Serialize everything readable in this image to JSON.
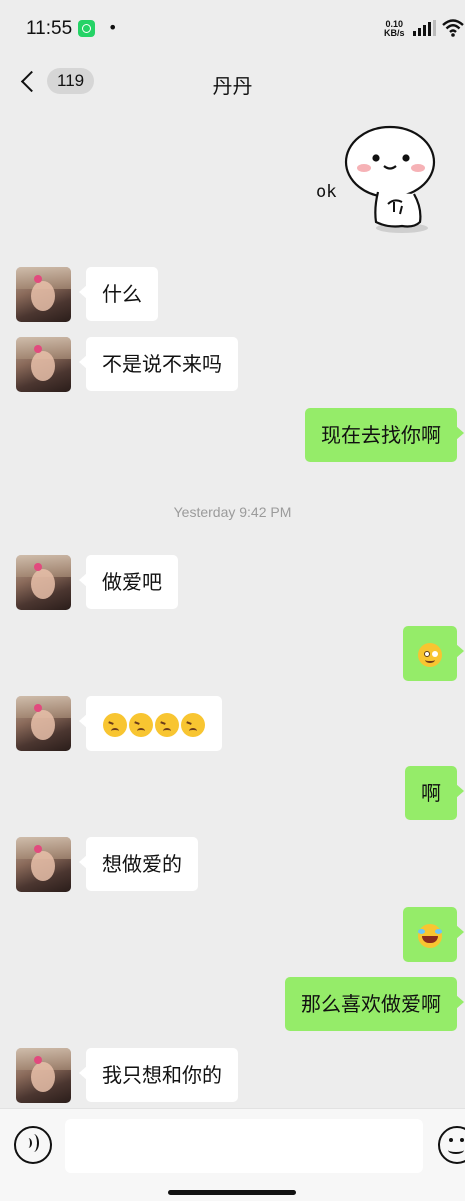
{
  "status": {
    "time": "11:55",
    "dot": "•",
    "speed_value": "0.10",
    "speed_unit": "KB/s"
  },
  "header": {
    "unread_count": "119",
    "title": "丹丹"
  },
  "sticker": {
    "text": "ok"
  },
  "messages": [
    {
      "side": "left",
      "text": "什么"
    },
    {
      "side": "left",
      "text": "不是说不来吗"
    },
    {
      "side": "right",
      "text": "现在去找你啊"
    },
    {
      "side": "left",
      "text": "做爱吧"
    },
    {
      "side": "right",
      "text": "",
      "emoji": "smile"
    },
    {
      "side": "left",
      "text": "",
      "emoji": "sweat x4"
    },
    {
      "side": "right",
      "text": "啊"
    },
    {
      "side": "left",
      "text": "想做爱的"
    },
    {
      "side": "right",
      "text": "",
      "emoji": "laugh"
    },
    {
      "side": "right",
      "text": "那么喜欢做爱啊"
    },
    {
      "side": "left",
      "text": "我只想和你的"
    }
  ],
  "timestamp": "Yesterday 9:42 PM",
  "colors": {
    "background": "#ededed",
    "sent_bubble": "#95ec69",
    "received_bubble": "#ffffff"
  },
  "icons": [
    "whatsapp-icon",
    "signal-icon",
    "wifi-icon",
    "back-chevron-icon",
    "voice-icon",
    "emoji-icon"
  ]
}
